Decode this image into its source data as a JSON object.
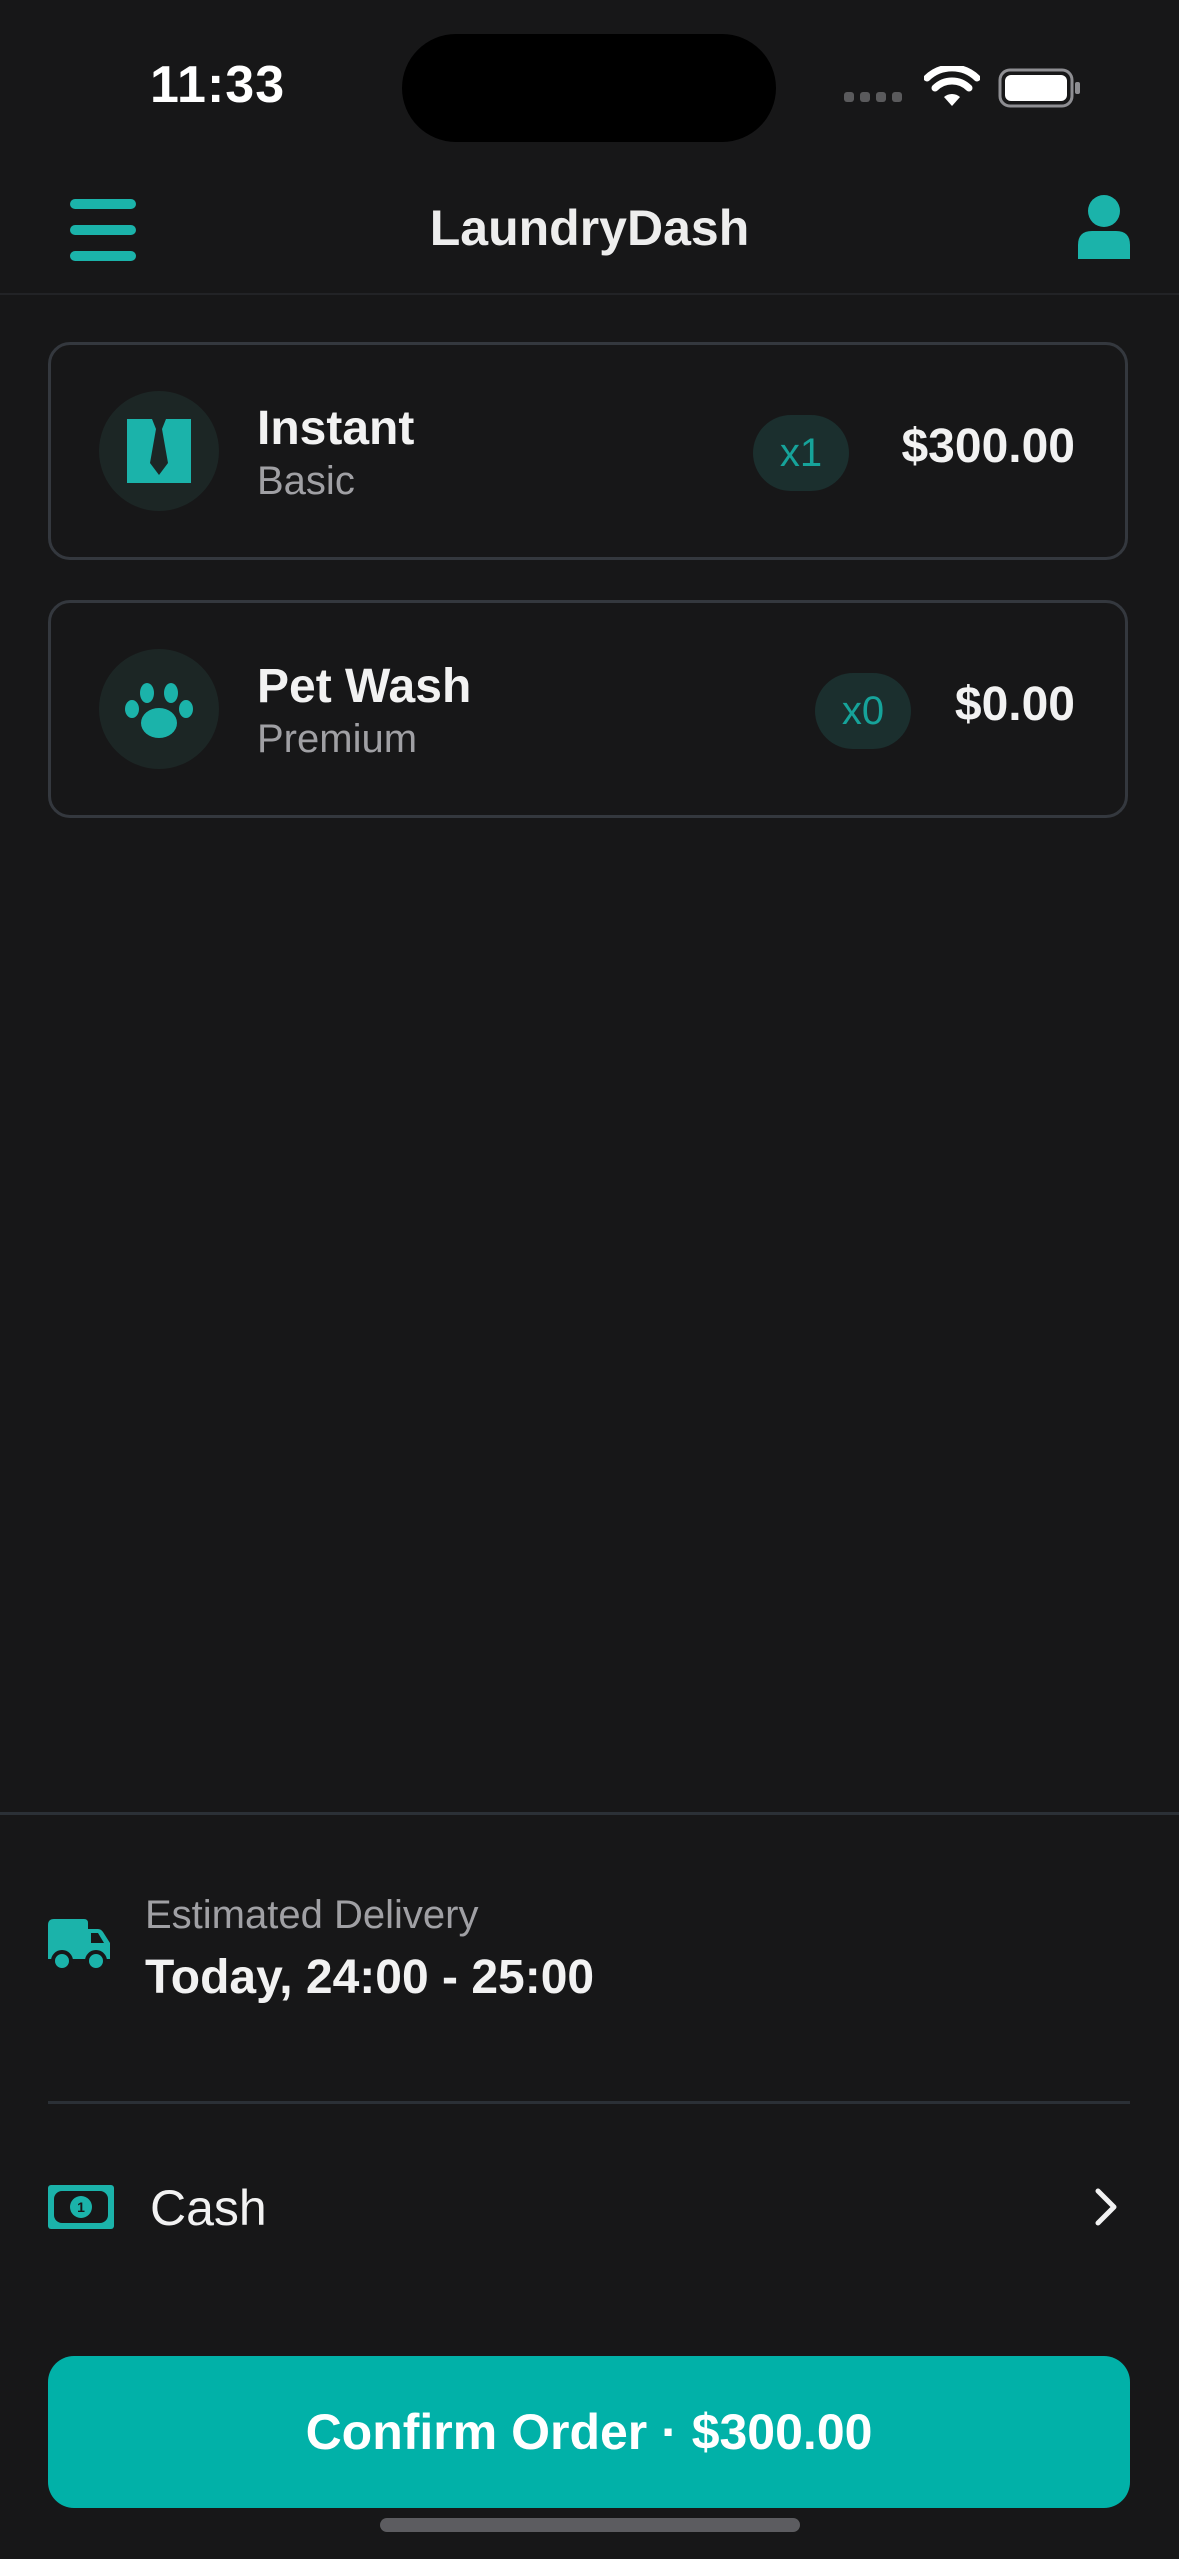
{
  "status_bar": {
    "time": "11:33"
  },
  "header": {
    "title": "LaundryDash",
    "menu_icon": "hamburger-menu-icon",
    "profile_icon": "user-icon"
  },
  "services": [
    {
      "name": "Instant",
      "tier": "Basic",
      "quantity": "x1",
      "price": "$300.00",
      "icon": "shirt-tie-icon"
    },
    {
      "name": "Pet Wash",
      "tier": "Premium",
      "quantity": "x0",
      "price": "$0.00",
      "icon": "paw-icon"
    }
  ],
  "delivery": {
    "label": "Estimated Delivery",
    "time": "Today, 24:00 - 25:00",
    "icon": "truck-icon"
  },
  "payment": {
    "method": "Cash",
    "icon": "cash-icon"
  },
  "confirm": {
    "label": "Confirm Order · $300.00"
  },
  "colors": {
    "accent": "#01b1a8",
    "background": "#171718",
    "card_border": "#34383e",
    "muted_text": "#a0a0a4"
  }
}
